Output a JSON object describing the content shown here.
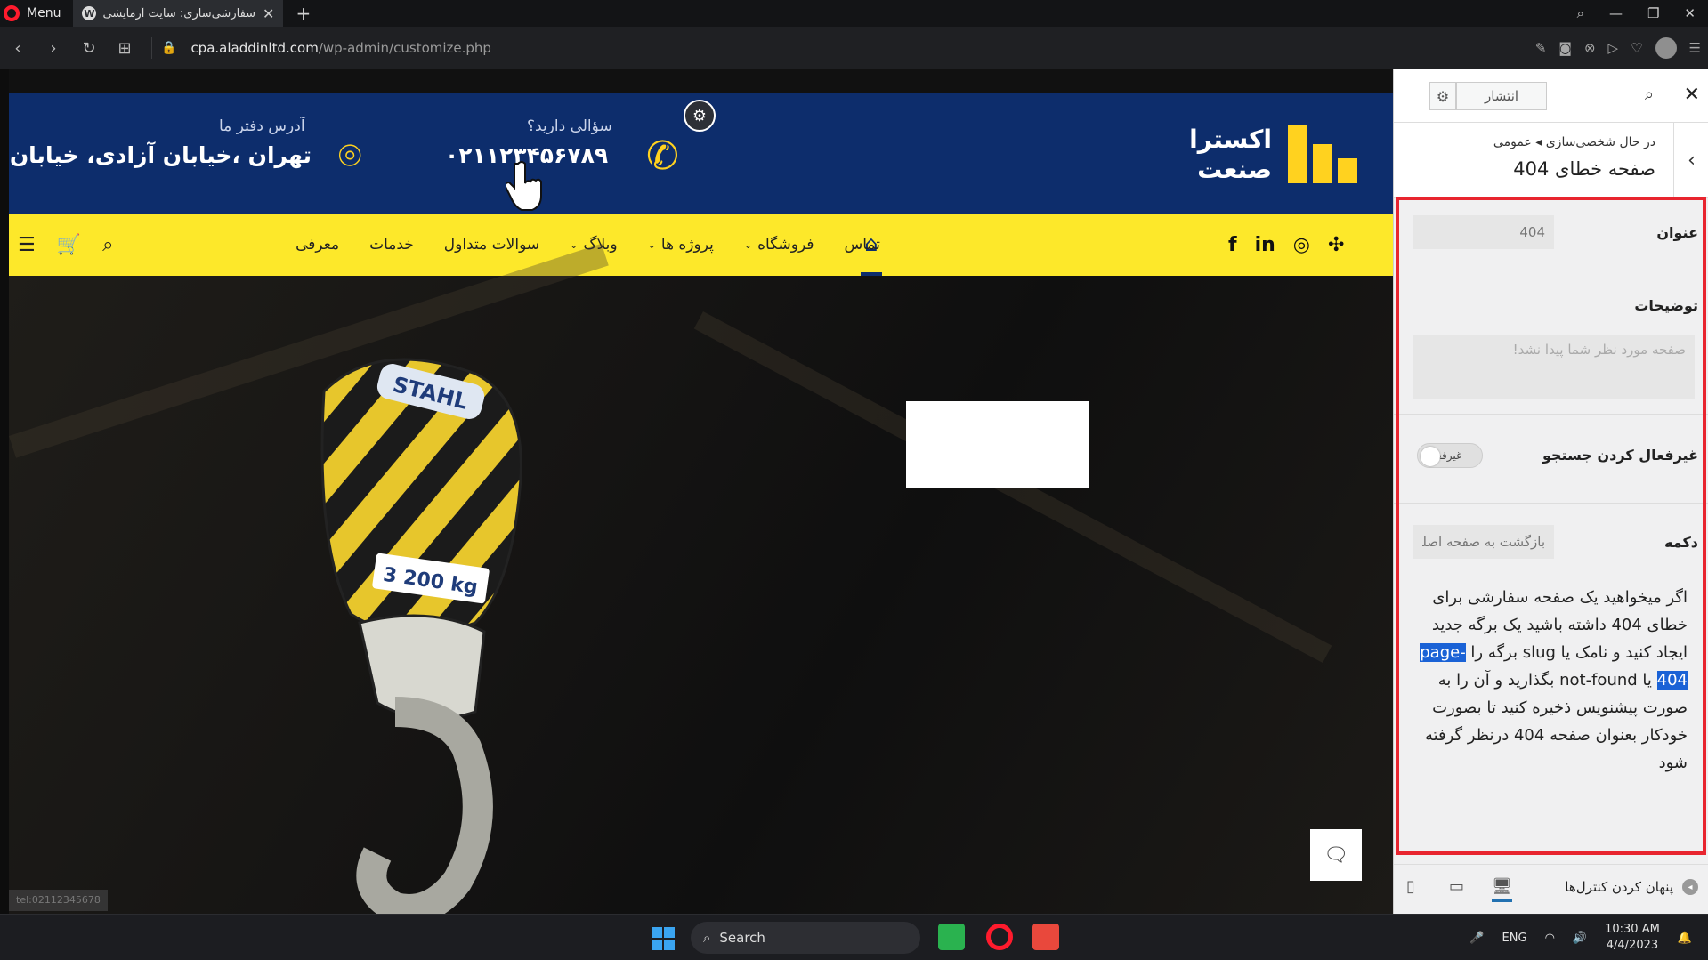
{
  "browser": {
    "menu_label": "Menu",
    "tab_title": "سفارشی‌سازی: سایت آزمایشی علاءالدین",
    "new_tab": "+",
    "url_host": "cpa.aladdinltd.com",
    "url_path": "/wp-admin/customize.php"
  },
  "site": {
    "logo_line1": "اکسترا",
    "logo_line2": "صنعت",
    "phone_label": "سؤالی دارید؟",
    "phone_value": "۰۲۱۱۲۳۴۵۶۷۸۹",
    "address_label": "آدرس دفتر ما",
    "address_value": "تهران ،خیابان آزادی، خیابان بهبودی",
    "nav": [
      {
        "label": "معرفی",
        "dropdown": false
      },
      {
        "label": "خدمات",
        "dropdown": false
      },
      {
        "label": "سوالات متداول",
        "dropdown": false
      },
      {
        "label": "وبلاگ",
        "dropdown": true
      },
      {
        "label": "پروژه ها",
        "dropdown": true
      },
      {
        "label": "فروشگاه",
        "dropdown": true
      },
      {
        "label": "تماس",
        "dropdown": false
      }
    ],
    "social": [
      "f",
      "in",
      "instagram-icon",
      "xbox-icon"
    ],
    "hoist_brand": "STAHL",
    "hoist_capacity": "3 200 kg",
    "status_url": "tel:02112345678"
  },
  "customizer": {
    "publish_label": "انتشار",
    "breadcrumb_prefix": "در حال شخصی‌سازی",
    "breadcrumb_section": "عمومی",
    "section_title": "صفحه خطای 404",
    "fields": {
      "title_label": "عنوان",
      "title_placeholder": "404",
      "description_label": "توضیحات",
      "description_placeholder": "صفحه مورد نظر شما پیدا نشد!",
      "disable_search_label": "غیرفعال کردن جستجو",
      "disable_search_state": "غیرفعال",
      "button_label": "دکمه",
      "button_placeholder": "بازگشت به صفحه اصلی"
    },
    "help_before": "اگر میخواهید یک صفحه سفارشی برای خطای 404 داشته باشید یک برگه جدید ایجاد کنید و نامک یا slug برگه را ",
    "help_highlight": "page-404",
    "help_after": " یا not-found بگذارید و آن را به صورت پیشنویس ذخیره کنید تا بصورت خودکار بعنوان صفحه 404 درنظر گرفته شود",
    "hide_controls_label": "پنهان کردن کنترل‌ها"
  },
  "taskbar": {
    "search_label": "Search",
    "lang": "ENG",
    "time": "10:30 AM",
    "date": "4/4/2023"
  },
  "colors": {
    "site_blue": "#0d2d6c",
    "site_yellow": "#fde82a",
    "logo_yellow": "#ffd21f",
    "frame_red": "#e8252f",
    "highlight_blue": "#1a62d6"
  }
}
